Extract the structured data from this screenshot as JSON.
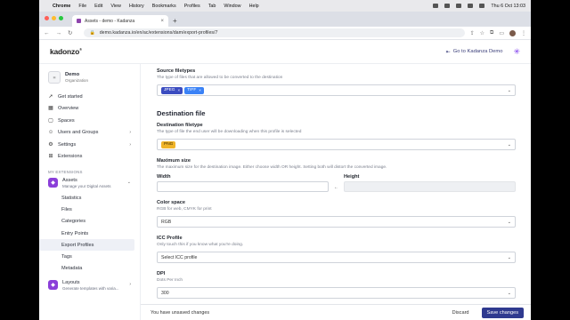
{
  "menubar": {
    "app": "Chrome",
    "items": [
      "File",
      "Edit",
      "View",
      "History",
      "Bookmarks",
      "Profiles",
      "Tab",
      "Window",
      "Help"
    ],
    "clock": "Thu 6 Oct  13:03"
  },
  "browser": {
    "tab_title": "Assets - demo - Kadanza",
    "url": "demo.kadanza.io/en/ac/extensions/dam/export-profiles/7"
  },
  "header": {
    "logo": "kadonzo",
    "goto_label": "Go to Kadanza Demo"
  },
  "sidebar": {
    "org_name": "Demo",
    "org_sub": "Organization",
    "items": [
      {
        "label": "Get started",
        "icon": "rocket-icon"
      },
      {
        "label": "Overview",
        "icon": "grid-icon"
      },
      {
        "label": "Spaces",
        "icon": "spaces-icon"
      },
      {
        "label": "Users and Groups",
        "icon": "users-icon"
      },
      {
        "label": "Settings",
        "icon": "gear-icon"
      },
      {
        "label": "Extensions",
        "icon": "extensions-icon"
      }
    ],
    "section_label": "MY EXTENSIONS",
    "assets": {
      "name": "Assets",
      "desc": "Manage your Digital Assets"
    },
    "asset_subitems": [
      "Statistics",
      "Files",
      "Categories",
      "Entry Points",
      "Export Profiles",
      "Tags",
      "Metadata"
    ],
    "layouts": {
      "name": "Layouts",
      "desc": "Generate templates with varia..."
    }
  },
  "form": {
    "source": {
      "title": "Source filetypes",
      "desc": "The type of files that are allowed to be converted to the destination",
      "chips": [
        "JPEG",
        "TIFF"
      ]
    },
    "destination_heading": "Destination file",
    "dest_filetype": {
      "title": "Destination filetype",
      "desc": "The type of file the end user will be downloading when this profile is selected",
      "value": "PNG"
    },
    "max_size": {
      "title": "Maximum size",
      "desc": "The maximum size for the destination image. Either choose width OR height. Setting both will distort the converted image.",
      "width_label": "Width",
      "height_label": "Height",
      "link_icon": "←"
    },
    "color_space": {
      "title": "Color space",
      "desc": "RGB for web, CMYK for print",
      "value": "RGB"
    },
    "icc": {
      "title": "ICC Profile",
      "desc": "Only touch this if you know what you're doing.",
      "value": "Select ICC profile"
    },
    "dpi": {
      "title": "DPI",
      "desc": "Dots Per Inch",
      "value": "300"
    }
  },
  "footer": {
    "unsaved": "You have unsaved changes",
    "discard": "Discard",
    "save": "Save changes"
  },
  "colors": {
    "accent": "#2f3a8f",
    "chip_jpeg": "#3b4cc0",
    "chip_tiff": "#3b82f6",
    "chip_png": "#f0b429",
    "extension": "#8b3fd9"
  }
}
